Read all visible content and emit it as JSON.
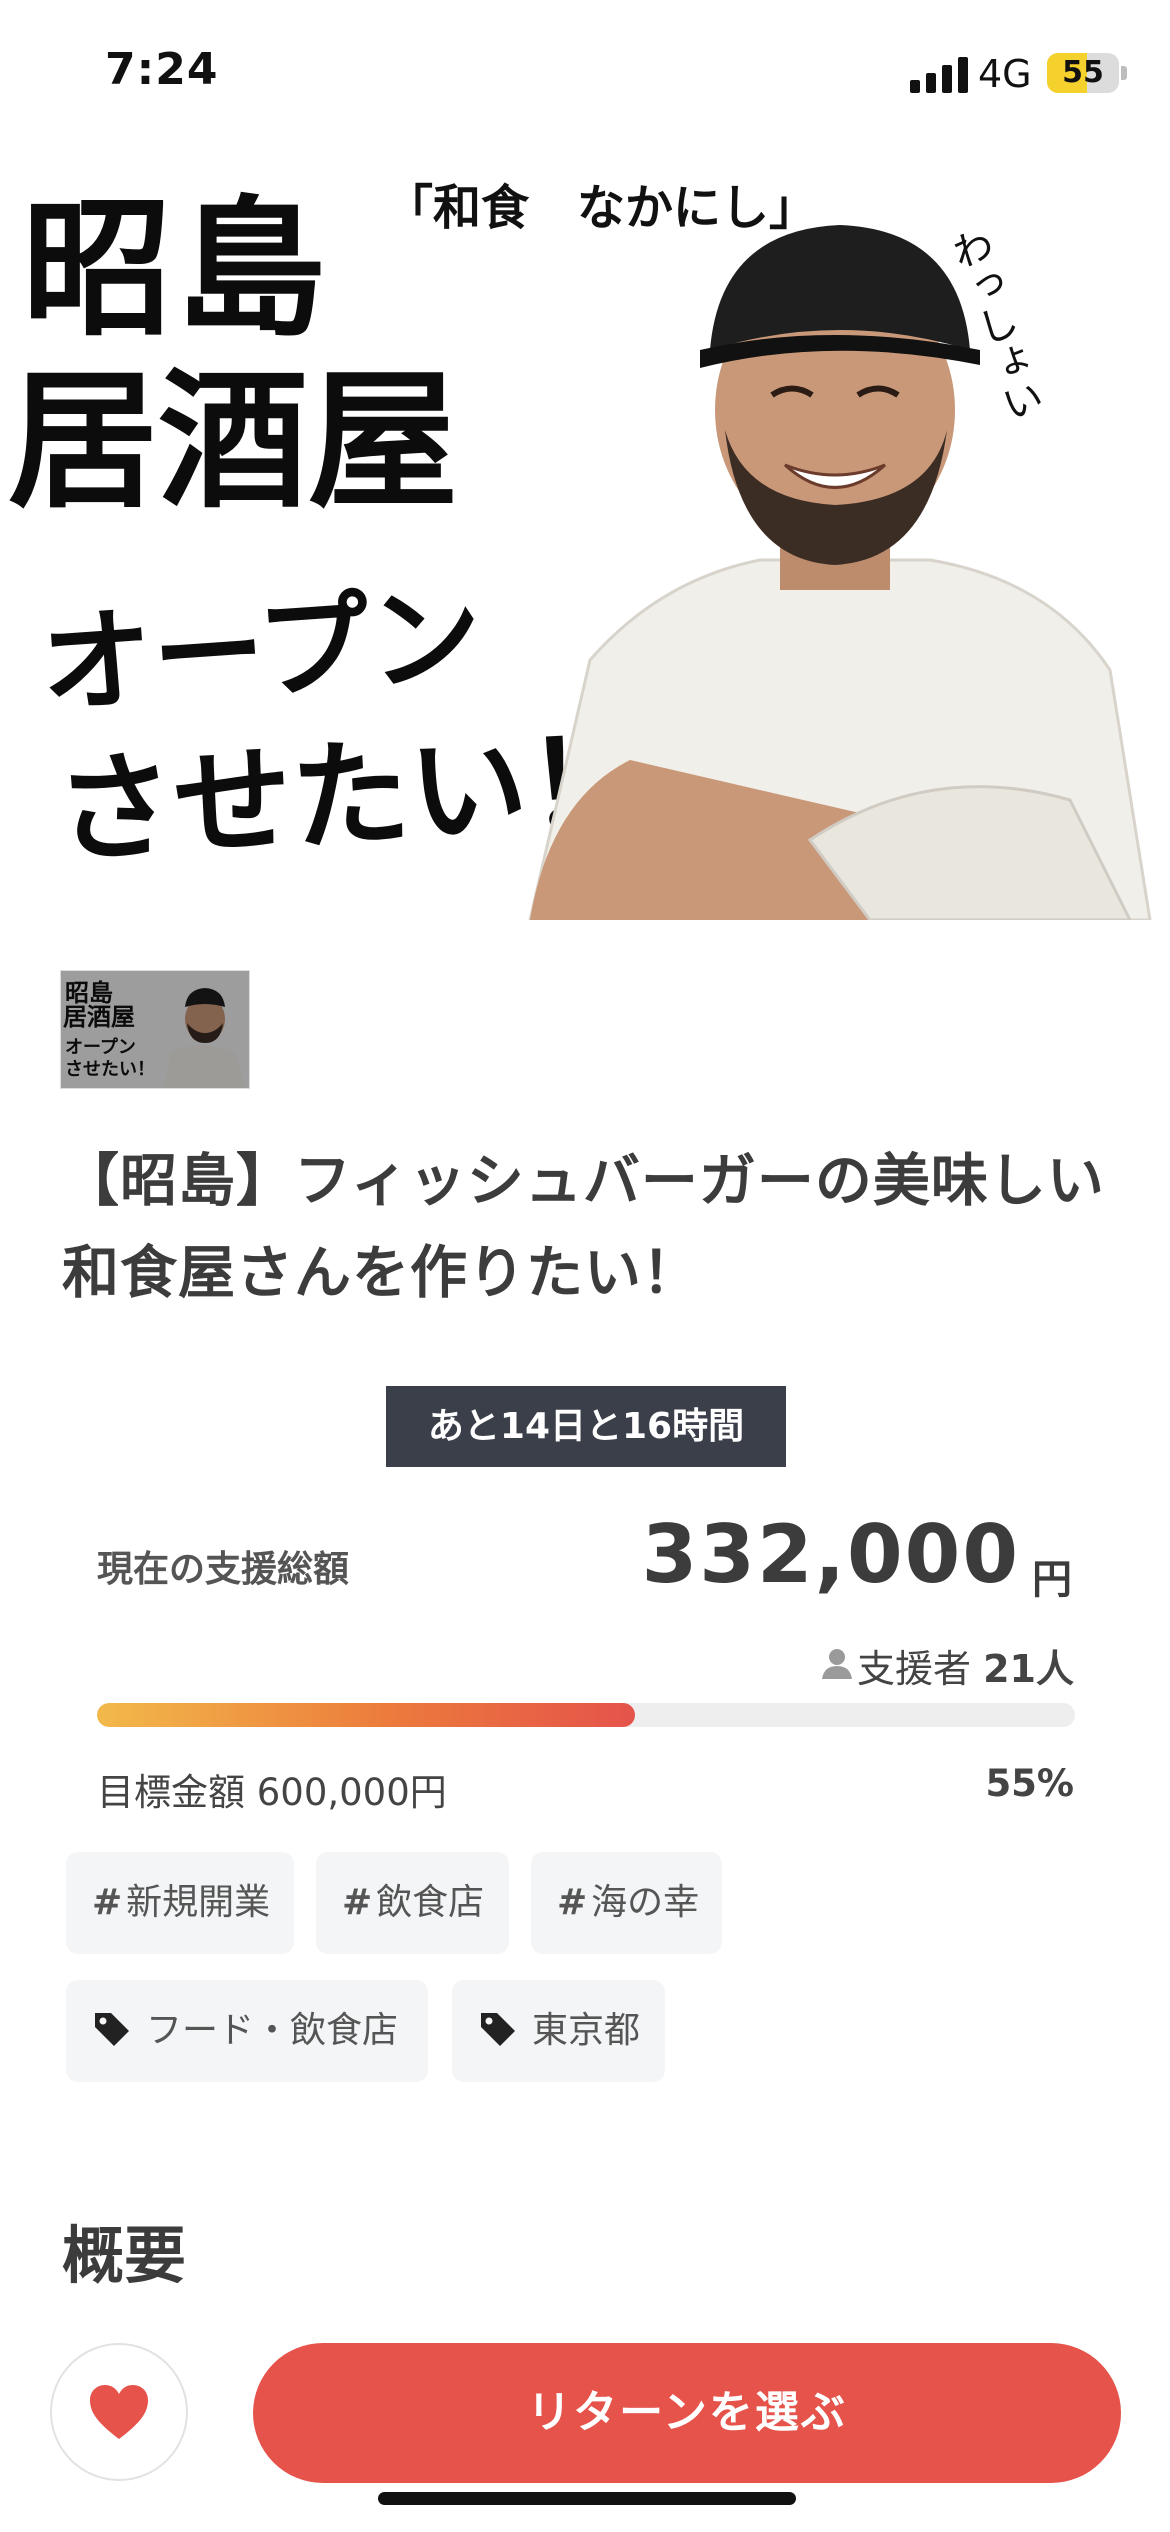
{
  "status_bar": {
    "time": "7:24",
    "network": "4G",
    "battery": "55",
    "battery_level": 0.55
  },
  "hero": {
    "line1": "昭島",
    "line2": "居酒屋",
    "restaurant": "「和食　なかにし」",
    "line3": "オープン",
    "line4": "させたい！",
    "handwritten": "わっしょい"
  },
  "project": {
    "title": "【昭島】フィッシュバーガーの美味しい和食屋さんを作りたい！",
    "time_remaining": "あと14日と16時間",
    "total_label": "現在の支援総額",
    "amount": "332,000",
    "currency": "円",
    "backers_label": "支援者",
    "backers_count": "21人",
    "goal_label": "目標金額 600,000円",
    "percent": "55%",
    "progress": 0.55
  },
  "hashtags": [
    {
      "hash": "#",
      "label": "新規開業"
    },
    {
      "hash": "#",
      "label": "飲食店"
    },
    {
      "hash": "#",
      "label": "海の幸"
    }
  ],
  "categories": [
    {
      "label": "フード・飲食店",
      "icon": "tag-icon"
    },
    {
      "label": "東京都",
      "icon": "tag-icon"
    }
  ],
  "section": {
    "overview": "概要"
  },
  "footer": {
    "favorite_icon": "heart-icon",
    "cta_label": "リターンを選ぶ"
  },
  "colors": {
    "accent": "#e5534b",
    "dark_badge": "#3a3f4a",
    "progress_start": "#f2b94a",
    "progress_end": "#e5534b",
    "battery": "#f5d12e"
  }
}
